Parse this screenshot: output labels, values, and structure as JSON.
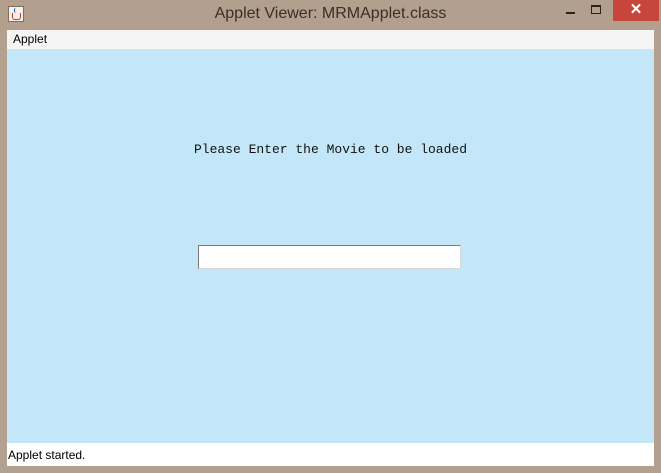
{
  "window": {
    "title": "Applet Viewer: MRMApplet.class",
    "close_glyph": "✕"
  },
  "menubar": {
    "items": [
      {
        "label": "Applet"
      }
    ]
  },
  "applet": {
    "prompt": "Please Enter the Movie to be loaded",
    "movie_input": {
      "value": "",
      "placeholder": ""
    }
  },
  "status": {
    "text": "Applet started."
  },
  "colors": {
    "titlebar": "#b39f8e",
    "applet_background": "#c3e7f8",
    "close_button": "#c7463c"
  },
  "icons": {
    "app_icon": "java-cup-icon",
    "minimize": "minimize-icon",
    "maximize": "maximize-icon",
    "close": "close-icon"
  }
}
